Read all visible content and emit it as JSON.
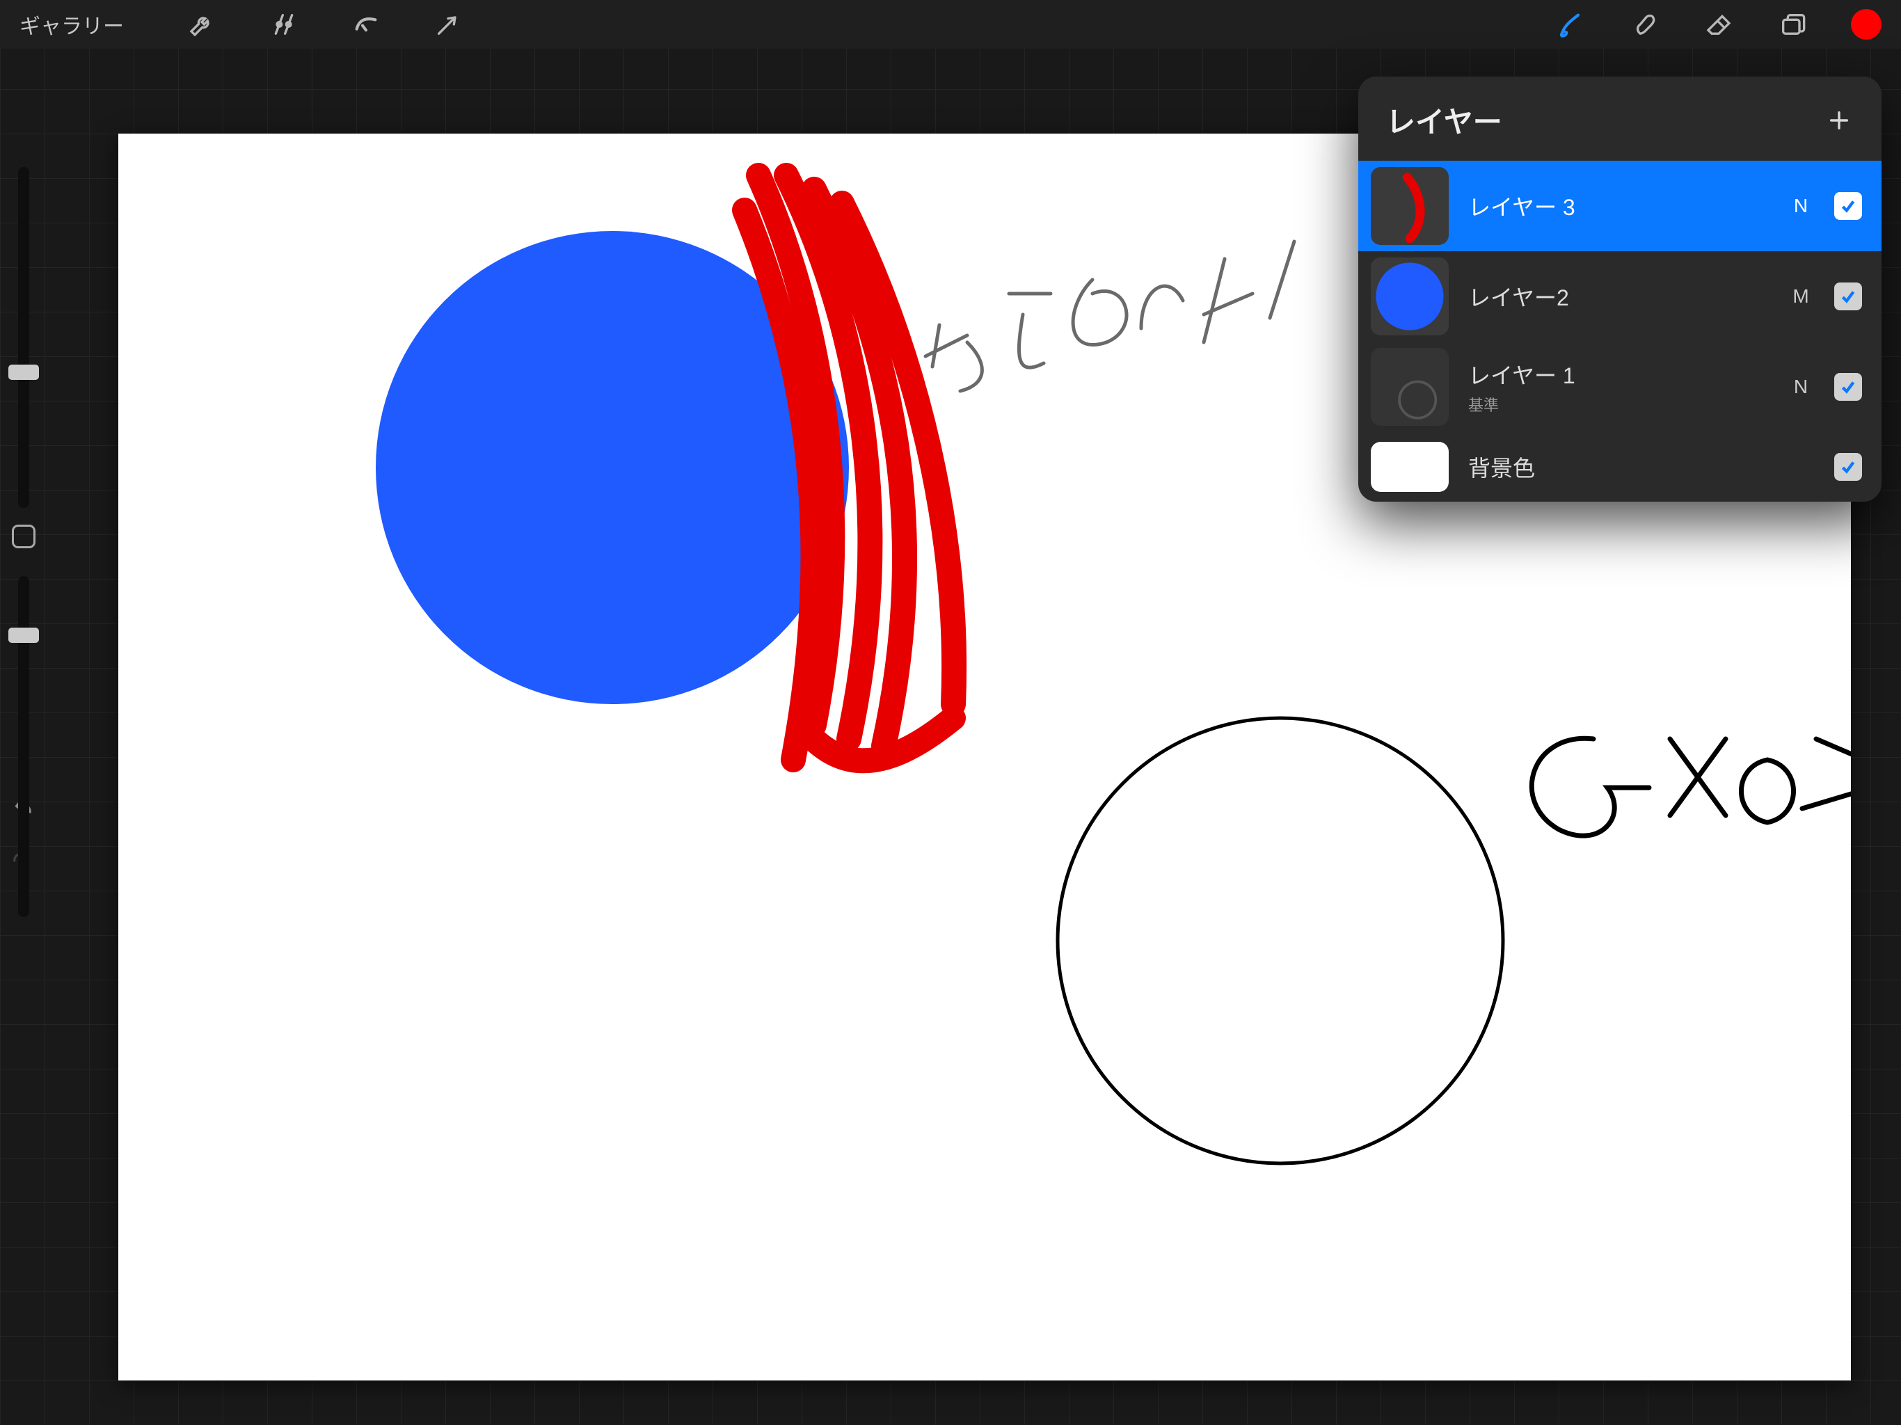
{
  "gallery_label": "ギャラリー",
  "current_color": "#ff0000",
  "canvas": {
    "annotation_pencil": "えんぴつ!",
    "annotation_gpen": "Gペン!"
  },
  "brush_slider_pct": 40,
  "opacity_slider_pct": 82,
  "layers_panel": {
    "title": "レイヤー",
    "items": [
      {
        "name": "レイヤー 3",
        "blend": "N",
        "visible": true,
        "selected": true,
        "thumb": "red-stroke"
      },
      {
        "name": "レイヤー2",
        "blend": "M",
        "visible": true,
        "selected": false,
        "thumb": "blue-circle"
      },
      {
        "name": "レイヤー 1",
        "sub": "基準",
        "blend": "N",
        "visible": true,
        "selected": false,
        "thumb": "faint-circle"
      },
      {
        "name": "背景色",
        "blend": "",
        "visible": true,
        "selected": false,
        "thumb": "white",
        "is_bg": true
      }
    ]
  }
}
